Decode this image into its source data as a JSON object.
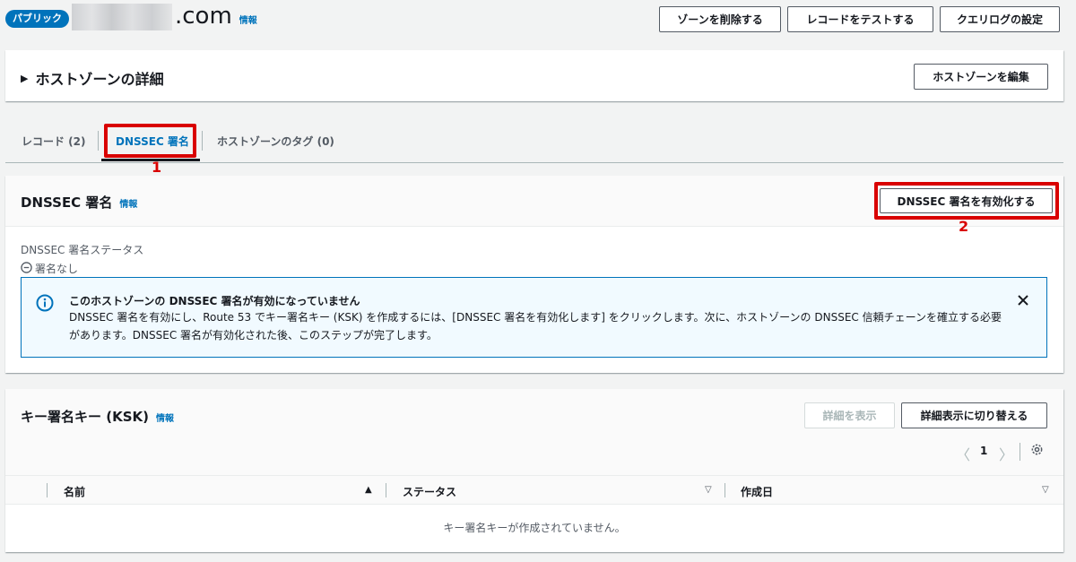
{
  "header": {
    "badge": "パブリック",
    "domain_suffix": ".com",
    "info": "情報",
    "buttons": [
      "ゾーンを削除する",
      "レコードをテストする",
      "クエリログの設定"
    ]
  },
  "zone_details": {
    "title": "ホストゾーンの詳細",
    "edit_button": "ホストゾーンを編集"
  },
  "tabs": [
    {
      "label": "レコード (2)"
    },
    {
      "label": "DNSSEC 署名",
      "active": true
    },
    {
      "label": "ホストゾーンのタグ (0)"
    }
  ],
  "annotations": {
    "step1": "1",
    "step2": "2"
  },
  "dnssec": {
    "title": "DNSSEC 署名",
    "info": "情報",
    "enable_button": "DNSSEC 署名を有効化する",
    "status_label": "DNSSEC 署名ステータス",
    "status_value": "署名なし",
    "alert": {
      "title": "このホストゾーンの DNSSEC 署名が有効になっていません",
      "line1": "DNSSEC 署名を有効にし、Route 53 でキー署名キー (KSK) を作成するには、[DNSSEC 署名を有効化します] をクリックします。次に、ホストゾーンの DNSSEC 信頼チェーンを確立する必要",
      "line2": "があります。DNSSEC 署名が有効化された後、このステップが完了します。"
    }
  },
  "ksk": {
    "title": "キー署名キー (KSK)",
    "info": "情報",
    "view_details_button": "詳細を表示",
    "toggle_button": "詳細表示に切り替える",
    "page_number": "1",
    "columns": [
      "名前",
      "ステータス",
      "作成日"
    ],
    "empty_message": "キー署名キーが作成されていません。"
  },
  "colors": {
    "accent": "#0073bb",
    "highlight": "#d90000"
  }
}
